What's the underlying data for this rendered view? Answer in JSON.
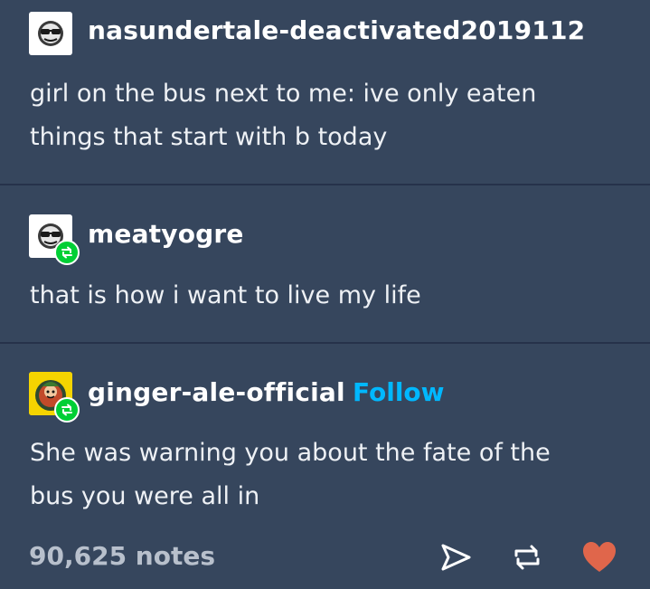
{
  "posts": [
    {
      "username": "nasundertale-deactivated2019112",
      "text": "girl on the bus next to me: ive only eaten\nthings that start with b today"
    },
    {
      "username": "meatyogre",
      "text": "that is how i want to live my life"
    },
    {
      "username": "ginger-ale-official",
      "follow_label": "Follow",
      "text": "She was warning you about the fate of the\nbus you were all in"
    }
  ],
  "footer": {
    "notes": "90,625 notes"
  },
  "colors": {
    "background": "#36465d",
    "divider": "#26324a",
    "reblog_badge": "#00cf35",
    "follow": "#00b8ff",
    "heart": "#e0664b"
  },
  "icons": {
    "avatar_1": "sunglasses-face-icon",
    "avatar_2": "sunglasses-face-icon",
    "avatar_3": "ginger-character-icon",
    "reblog_badge": "reblog-icon",
    "share": "share-icon",
    "reblog": "reblog-icon",
    "like": "heart-icon"
  }
}
